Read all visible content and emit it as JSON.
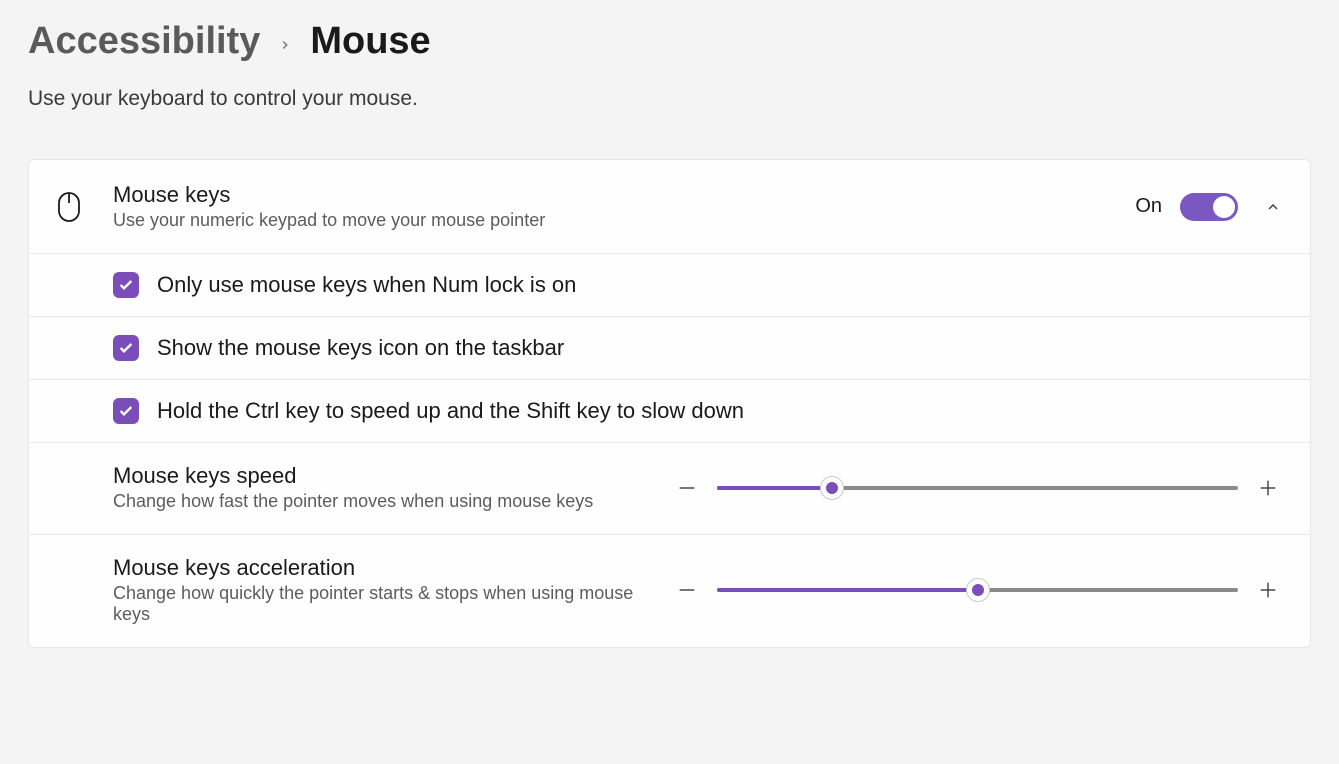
{
  "breadcrumb": {
    "parent": "Accessibility",
    "current": "Mouse"
  },
  "page_description": "Use your keyboard to control your mouse.",
  "mouse_keys": {
    "title": "Mouse keys",
    "description": "Use your numeric keypad to move your mouse pointer",
    "toggle_label": "On",
    "toggle_state": true
  },
  "options": {
    "numlock": {
      "label": "Only use mouse keys when Num lock is on",
      "checked": true
    },
    "taskbar_icon": {
      "label": "Show the mouse keys icon on the taskbar",
      "checked": true
    },
    "ctrl_shift": {
      "label": "Hold the Ctrl key to speed up and the Shift key to slow down",
      "checked": true
    }
  },
  "sliders": {
    "speed": {
      "title": "Mouse keys speed",
      "description": "Change how fast the pointer moves when using mouse keys",
      "value_percent": 22
    },
    "acceleration": {
      "title": "Mouse keys acceleration",
      "description": "Change how quickly the pointer starts & stops when using mouse keys",
      "value_percent": 50
    }
  },
  "colors": {
    "accent": "#7b4db8"
  }
}
